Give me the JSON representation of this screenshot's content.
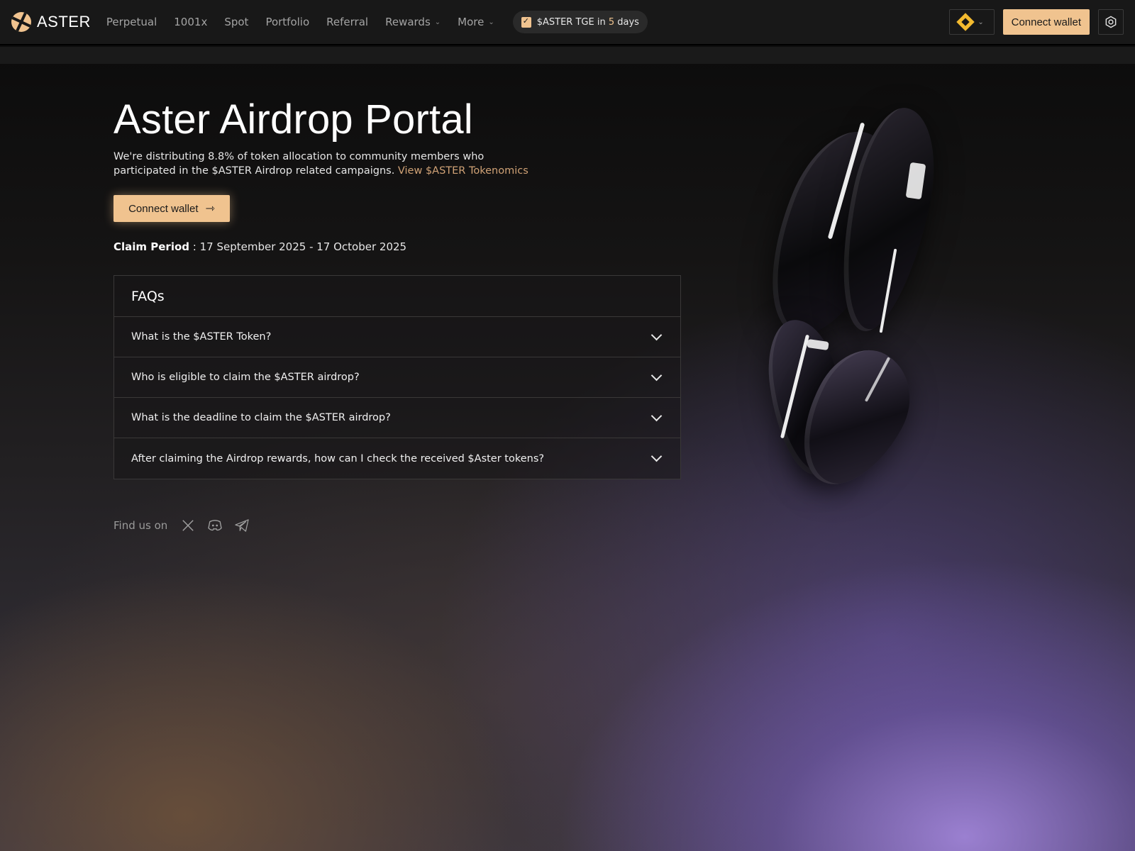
{
  "brand": {
    "name": "ASTER"
  },
  "nav": {
    "items": [
      {
        "label": "Perpetual"
      },
      {
        "label": "1001x"
      },
      {
        "label": "Spot"
      },
      {
        "label": "Portfolio"
      },
      {
        "label": "Referral"
      },
      {
        "label": "Rewards",
        "dropdown": true
      },
      {
        "label": "More",
        "dropdown": true
      }
    ]
  },
  "tge": {
    "prefix": "$ASTER TGE in",
    "count": "5",
    "suffix": "days"
  },
  "header": {
    "chain_icon": "bnb-chain-icon",
    "connect_label": "Connect wallet",
    "settings_icon": "settings-hex-icon"
  },
  "hero": {
    "title": "Aster Airdrop Portal",
    "description": "We're distributing 8.8% of token allocation to community members who participated in the $ASTER Airdrop related campaigns.",
    "link_label": "View $ASTER Tokenomics",
    "connect_label": "Connect wallet",
    "claim_label": "Claim Period",
    "claim_value": " : 17 September 2025 - 17 October 2025"
  },
  "faq": {
    "title": "FAQs",
    "items": [
      {
        "question": "What is the $ASTER Token?"
      },
      {
        "question": "Who is eligible to claim the $ASTER airdrop?"
      },
      {
        "question": "What is the deadline to claim the $ASTER airdrop?"
      },
      {
        "question": "After claiming the Airdrop rewards, how can I check the received $Aster tokens?"
      }
    ]
  },
  "social": {
    "label": "Find us on",
    "icons": [
      "x-icon",
      "discord-icon",
      "telegram-icon"
    ]
  },
  "colors": {
    "accent": "#f0c38f",
    "link": "#d0a276",
    "header_bg": "#181818"
  }
}
